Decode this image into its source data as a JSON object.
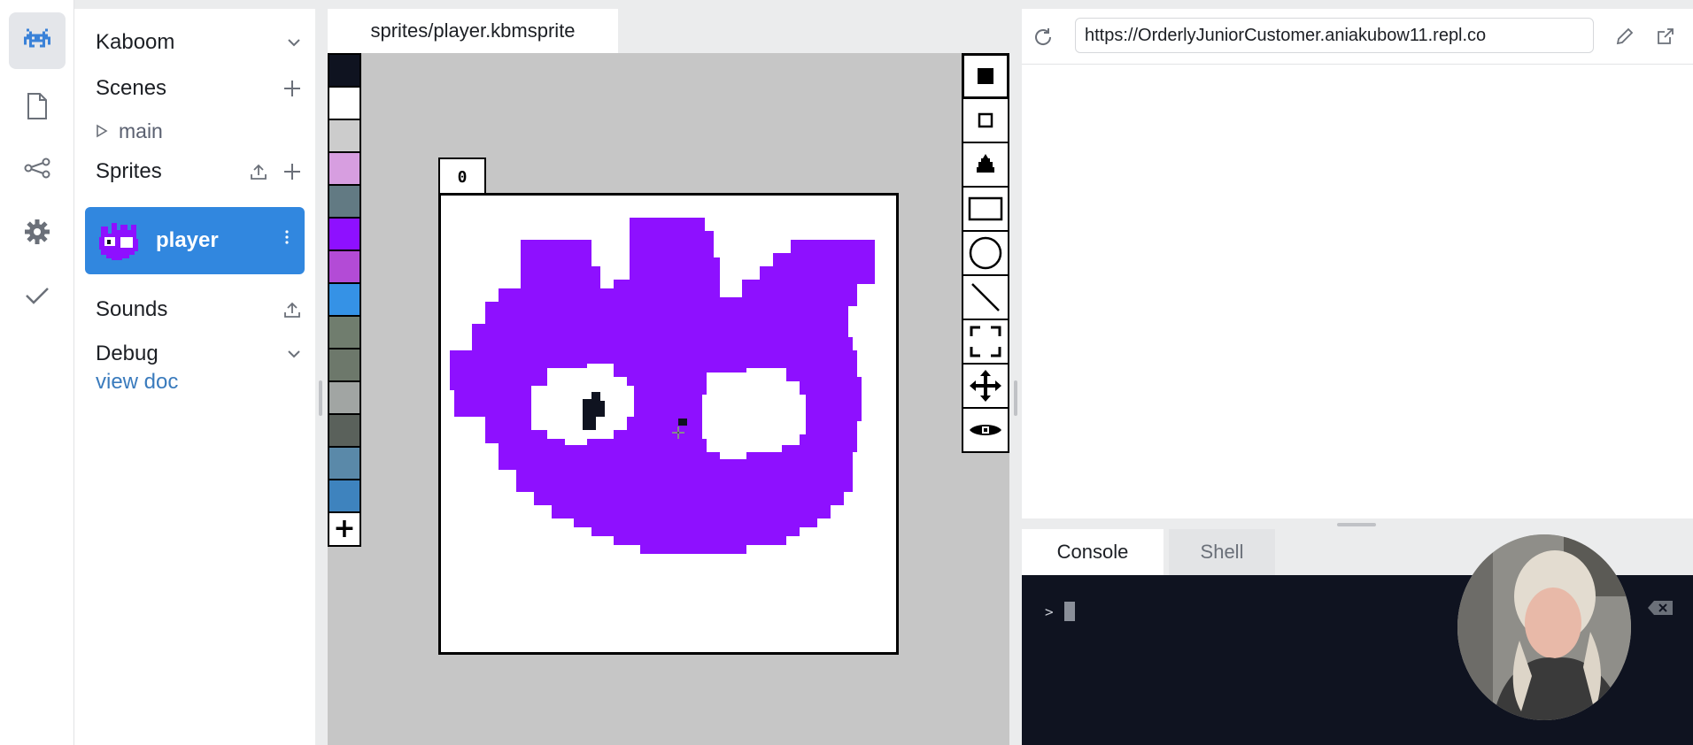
{
  "rail": {
    "items": [
      {
        "name": "kaboom-icon",
        "active": true
      },
      {
        "name": "file-icon",
        "active": false
      },
      {
        "name": "network-icon",
        "active": false
      },
      {
        "name": "gear-icon",
        "active": false
      },
      {
        "name": "check-icon",
        "active": false
      }
    ]
  },
  "sidebar": {
    "kaboom": "Kaboom",
    "scenes": "Scenes",
    "scene_items": [
      "main"
    ],
    "sprites": "Sprites",
    "sprite_items": [
      "player"
    ],
    "sounds": "Sounds",
    "debug": "Debug",
    "view_doc": "view doc"
  },
  "editor": {
    "tab": "sprites/player.kbmsprite",
    "frame_label": "0",
    "palette": [
      "#0f1320",
      "#ffffff",
      "#cccccc",
      "#d79ee0",
      "#627a83",
      "#8e10ff",
      "#b34bd6",
      "#3592e6",
      "#707d6e",
      "#6d786b",
      "#a1a5a3",
      "#5a615b",
      "#5a89a9",
      "#3e83be"
    ],
    "palette_add": "+",
    "tools": [
      "fill-square-icon",
      "outline-square-icon",
      "bucket-icon",
      "rectangle-icon",
      "circle-icon",
      "line-icon",
      "select-frame-icon",
      "move-icon",
      "eye-icon"
    ]
  },
  "webview": {
    "url": "https://OrderlyJuniorCustomer.aniakubow11.repl.co"
  },
  "console": {
    "tabs": [
      "Console",
      "Shell"
    ],
    "prompt": ">"
  },
  "colors": {
    "accent": "#3187df",
    "sprite_purple": "#8e10ff",
    "canvas_bg": "#c6c6c6",
    "console_bg": "#0f1320"
  }
}
